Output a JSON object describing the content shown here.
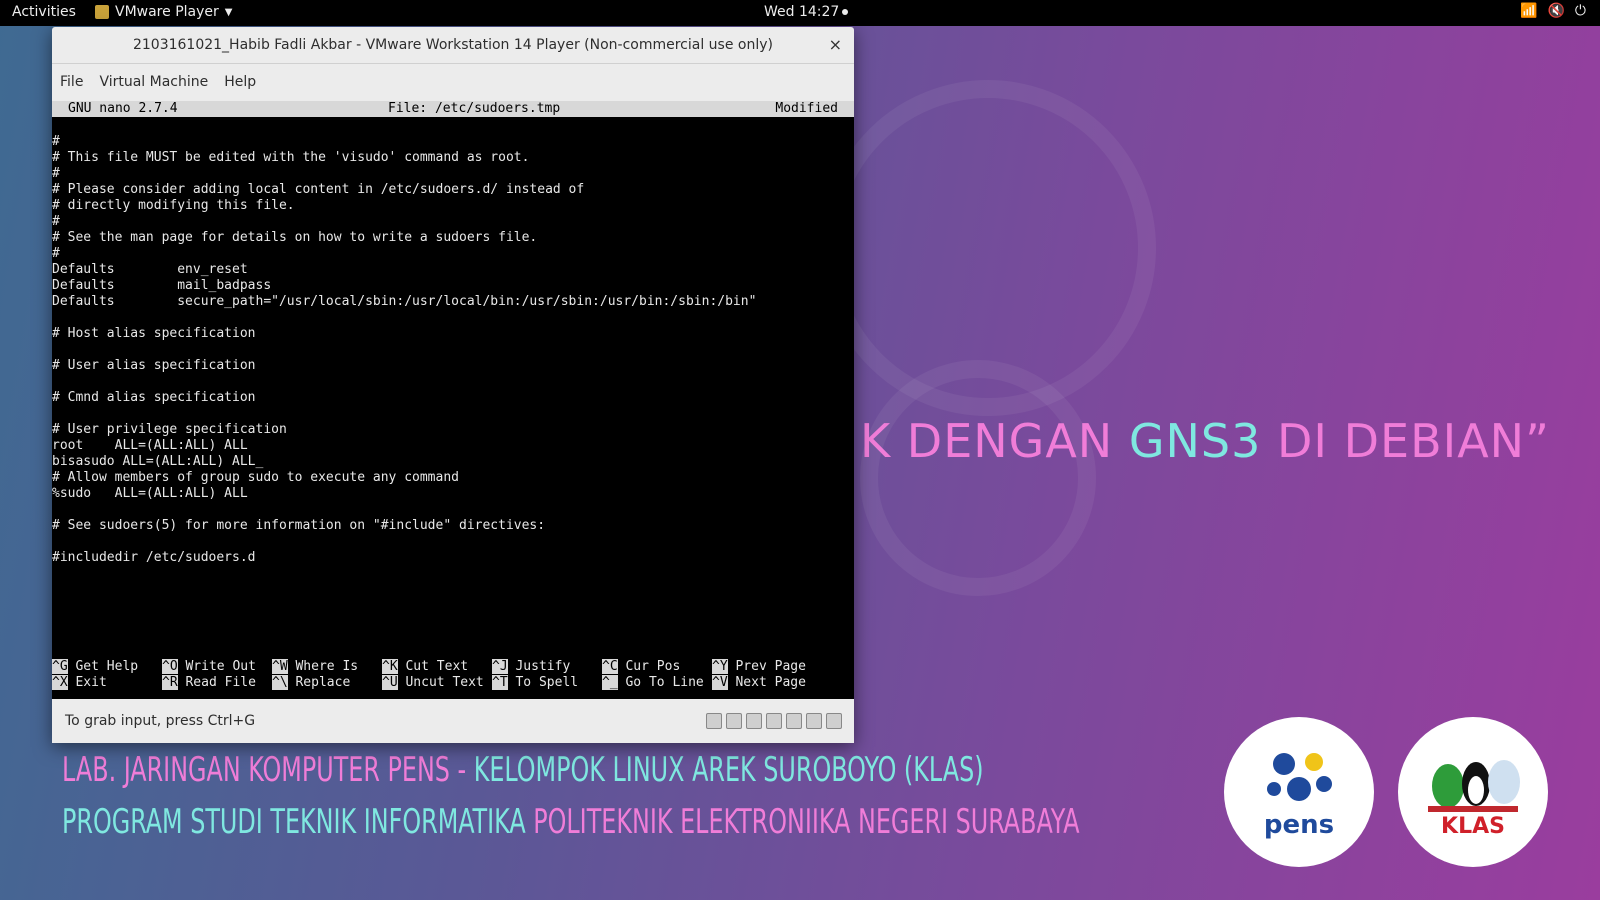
{
  "topbar": {
    "activities": "Activities",
    "app_name": "VMware Player",
    "clock": "Wed 14:27",
    "icons": [
      "wifi-icon",
      "volume-icon",
      "power-icon"
    ]
  },
  "background": {
    "title_part1": "K DENGAN ",
    "title_accent": "GNS3",
    "title_part2": " DI DEBIAN”",
    "line1_a": "LAB. JARINGAN KOMPUTER PENS - ",
    "line1_b": "KELOMPOK LINUX AREK SUROBOYO (KLAS)",
    "line2_a": "PROGRAM STUDI TEKNIK INFORMATIKA ",
    "line2_b": "POLITEKNIK ELEKTRONIIKA NEGERI SURABAYA",
    "logo_pens": "pens",
    "logo_klas": "KLAS"
  },
  "window": {
    "title": "2103161021_Habib Fadli Akbar - VMware Workstation 14 Player (Non-commercial use only)",
    "close": "×",
    "menu": [
      "File",
      "Virtual Machine",
      "Help"
    ],
    "status_msg": "To grab input, press Ctrl+G"
  },
  "nano": {
    "version": "GNU nano 2.7.4",
    "file": "File: /etc/sudoers.tmp",
    "state": "Modified",
    "lines": [
      "#",
      "# This file MUST be edited with the 'visudo' command as root.",
      "#",
      "# Please consider adding local content in /etc/sudoers.d/ instead of",
      "# directly modifying this file.",
      "#",
      "# See the man page for details on how to write a sudoers file.",
      "#",
      "Defaults        env_reset",
      "Defaults        mail_badpass",
      "Defaults        secure_path=\"/usr/local/sbin:/usr/local/bin:/usr/sbin:/usr/bin:/sbin:/bin\"",
      "",
      "# Host alias specification",
      "",
      "# User alias specification",
      "",
      "# Cmnd alias specification",
      "",
      "# User privilege specification",
      "root    ALL=(ALL:ALL) ALL",
      "bisasudo ALL=(ALL:ALL) ALL_",
      "# Allow members of group sudo to execute any command",
      "%sudo   ALL=(ALL:ALL) ALL",
      "",
      "# See sudoers(5) for more information on \"#include\" directives:",
      "",
      "#includedir /etc/sudoers.d"
    ],
    "shortcuts_row1": [
      {
        "key": "^G",
        "label": "Get Help"
      },
      {
        "key": "^O",
        "label": "Write Out"
      },
      {
        "key": "^W",
        "label": "Where Is"
      },
      {
        "key": "^K",
        "label": "Cut Text"
      },
      {
        "key": "^J",
        "label": "Justify"
      },
      {
        "key": "^C",
        "label": "Cur Pos"
      },
      {
        "key": "^Y",
        "label": "Prev Page"
      }
    ],
    "shortcuts_row2": [
      {
        "key": "^X",
        "label": "Exit"
      },
      {
        "key": "^R",
        "label": "Read File"
      },
      {
        "key": "^\\",
        "label": "Replace"
      },
      {
        "key": "^U",
        "label": "Uncut Text"
      },
      {
        "key": "^T",
        "label": "To Spell"
      },
      {
        "key": "^_",
        "label": "Go To Line"
      },
      {
        "key": "^V",
        "label": "Next Page"
      }
    ]
  }
}
